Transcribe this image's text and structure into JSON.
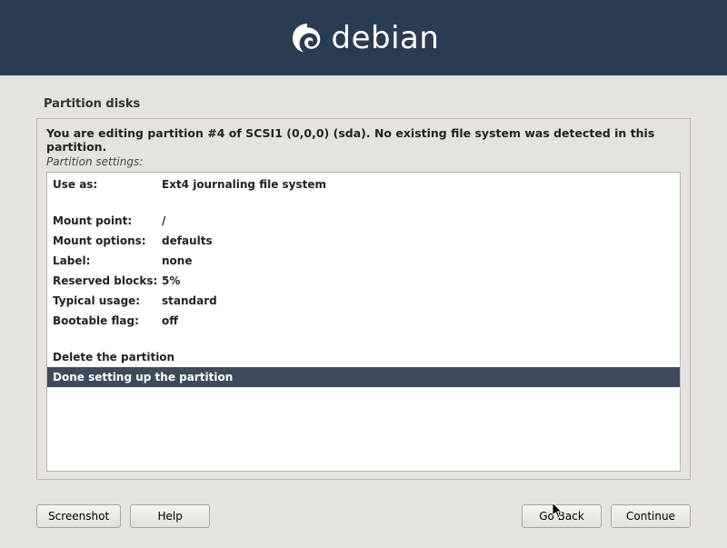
{
  "banner": {
    "brand": "debian"
  },
  "page": {
    "title": "Partition disks",
    "instruction": "You are editing partition #4 of SCSI1 (0,0,0) (sda). No existing file system was detected in this partition.",
    "subhead": "Partition settings:"
  },
  "settings": [
    {
      "key": "Use as:",
      "val": "Ext4 journaling file system"
    },
    {
      "spacer": true
    },
    {
      "key": "Mount point:",
      "val": "/"
    },
    {
      "key": "Mount options:",
      "val": "defaults"
    },
    {
      "key": "Label:",
      "val": "none"
    },
    {
      "key": "Reserved blocks:",
      "val": "5%"
    },
    {
      "key": "Typical usage:",
      "val": "standard"
    },
    {
      "key": "Bootable flag:",
      "val": "off"
    },
    {
      "spacer": true
    },
    {
      "action": "Delete the partition",
      "selected": false
    },
    {
      "action": "Done setting up the partition",
      "selected": true
    }
  ],
  "buttons": {
    "screenshot": "Screenshot",
    "help": "Help",
    "goback": "Go Back",
    "continue": "Continue"
  }
}
